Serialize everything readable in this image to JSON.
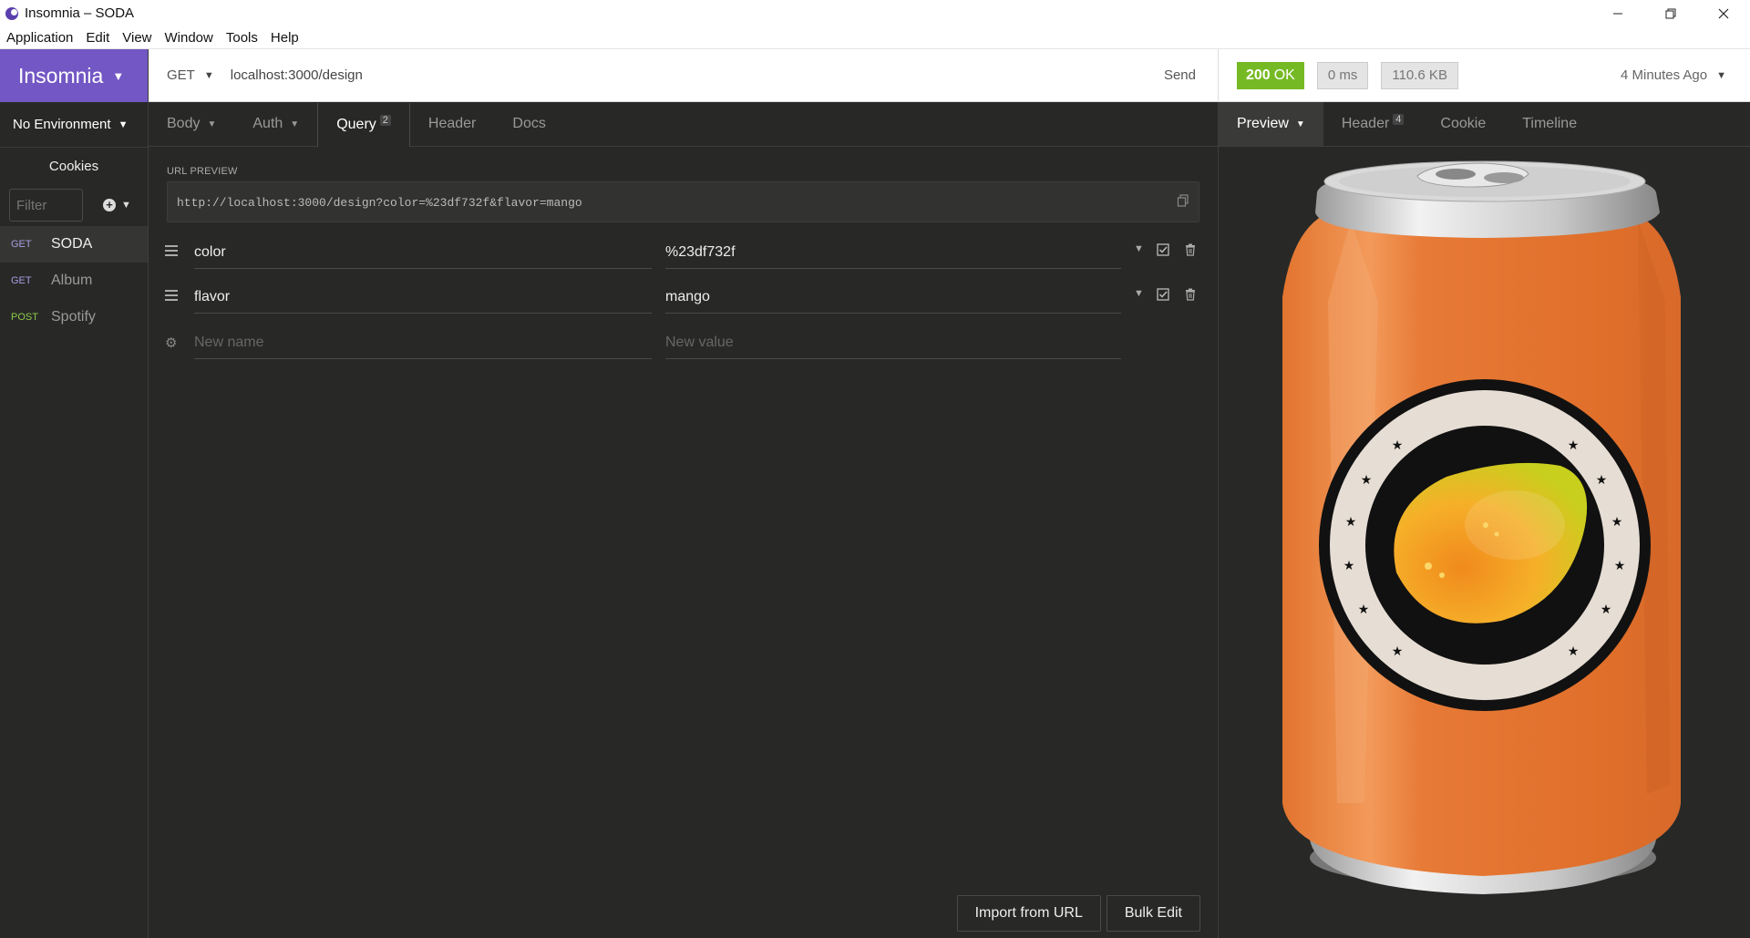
{
  "window": {
    "title": "Insomnia – SODA"
  },
  "menu": [
    "Application",
    "Edit",
    "View",
    "Window",
    "Tools",
    "Help"
  ],
  "sidebar": {
    "brand": "Insomnia",
    "environment": "No Environment",
    "cookies": "Cookies",
    "filter_placeholder": "Filter",
    "requests": [
      {
        "method": "GET",
        "name": "SODA"
      },
      {
        "method": "GET",
        "name": "Album"
      },
      {
        "method": "POST",
        "name": "Spotify"
      }
    ]
  },
  "request": {
    "method": "GET",
    "url": "localhost:3000/design",
    "send_label": "Send",
    "tabs": [
      {
        "label": "Body"
      },
      {
        "label": "Auth"
      },
      {
        "label": "Query",
        "badge": "2"
      },
      {
        "label": "Header"
      },
      {
        "label": "Docs"
      }
    ],
    "url_preview_label": "URL PREVIEW",
    "url_preview": "http://localhost:3000/design?color=%23df732f&flavor=mango",
    "params": [
      {
        "name": "color",
        "value": "%23df732f"
      },
      {
        "name": "flavor",
        "value": "mango"
      }
    ],
    "new_name_placeholder": "New name",
    "new_value_placeholder": "New value",
    "import_label": "Import from URL",
    "bulk_label": "Bulk Edit"
  },
  "response": {
    "status_code": "200",
    "status_text": "OK",
    "time": "0 ms",
    "size": "110.6 KB",
    "time_ago": "4 Minutes Ago",
    "tabs": [
      {
        "label": "Preview"
      },
      {
        "label": "Header",
        "badge": "4"
      },
      {
        "label": "Cookie"
      },
      {
        "label": "Timeline"
      }
    ],
    "preview": {
      "can_color": "#df732f",
      "flavor": "mango",
      "icon": "soda-can-image"
    }
  },
  "colors": {
    "brand": "#7357c4",
    "status_ok": "#75ba24",
    "get_method": "#a99be0",
    "post_method": "#8cc94a"
  }
}
